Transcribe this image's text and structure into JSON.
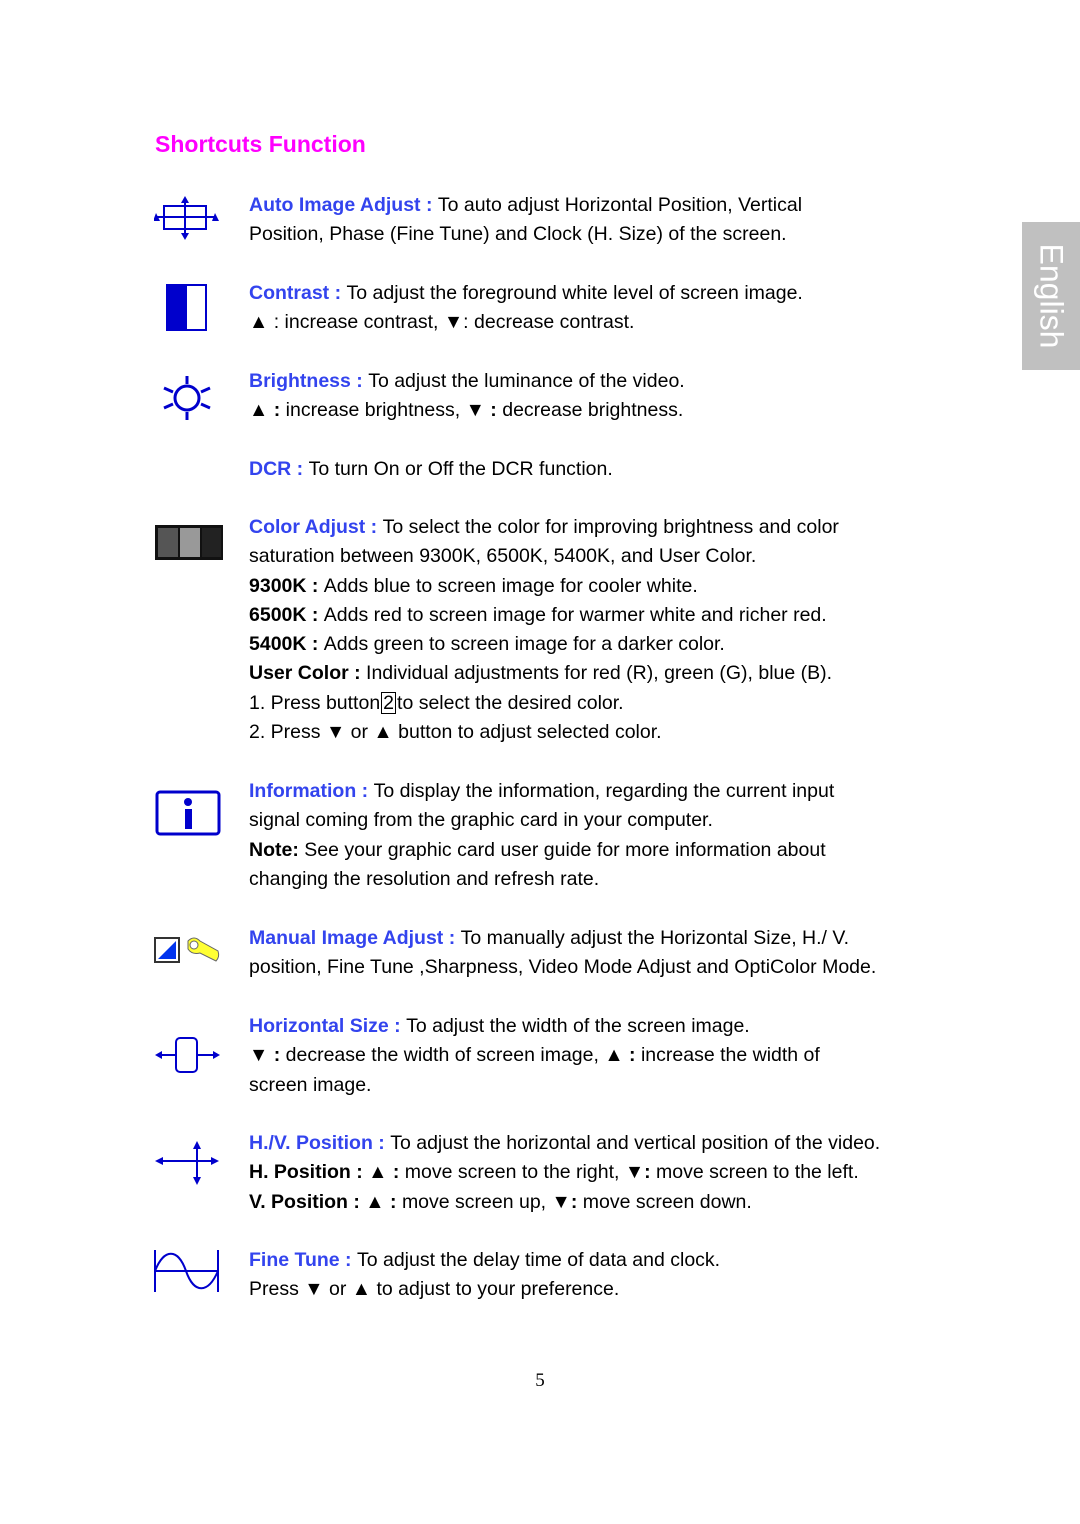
{
  "title": "Shortcuts Function",
  "side_tab": "English",
  "colors": {
    "title": "#ff00ff",
    "label": "#3344ee",
    "icon": "#0000cc",
    "tab_bg": "#c0c0c0"
  },
  "sections": {
    "auto": {
      "icon": "auto-image-adjust-icon",
      "label": "Auto Image Adjust : ",
      "line1": "To auto adjust Horizontal Position, Vertical",
      "line2": "Position, Phase (Fine Tune) and Clock (H. Size) of the screen."
    },
    "contrast": {
      "icon": "contrast-icon",
      "label": "Contrast : ",
      "line1": "To adjust the foreground white level of screen image.",
      "line2": "▲ : increase contrast, ▼: decrease contrast."
    },
    "brightness": {
      "icon": "brightness-icon",
      "label": "Brightness : ",
      "line1": "To adjust the luminance of the video.",
      "line2a": "▲ : ",
      "line2b": "increase brightness, ",
      "line2c": "▼ : ",
      "line2d": "decrease brightness."
    },
    "dcr": {
      "label": "DCR : ",
      "line1": "To turn On or Off the DCR function."
    },
    "color": {
      "icon": "color-adjust-icon",
      "label": "Color Adjust : ",
      "line1": "To select the color for improving brightness and color",
      "line2": "saturation between 9300K, 6500K, 5400K, and User Color.",
      "k9300_label": "9300K : ",
      "k9300": "Adds blue to screen image for cooler white.",
      "k6500_label": "6500K : ",
      "k6500": "Adds red to screen image for warmer white and richer red.",
      "k5400_label": "5400K : ",
      "k5400": "Adds green to screen image for a darker color.",
      "user_label": "User Color : ",
      "user": "Individual adjustments for red (R), green (G), blue (B).",
      "step1a": "1. Press button",
      "step1_btn": "2",
      "step1b": "to select the desired color.",
      "step2": "2. Press ▼ or ▲ button to adjust selected color."
    },
    "info": {
      "icon": "information-icon",
      "label": "Information : ",
      "line1": "To display the information, regarding the current input",
      "line2": "signal coming from the graphic card in your computer.",
      "note_label": "Note: ",
      "note": "See your graphic card user guide for more information about",
      "note2": "changing the resolution and refresh rate."
    },
    "manual": {
      "icon": "manual-image-adjust-icon",
      "label": "Manual Image Adjust : ",
      "line1": "To manually adjust the Horizontal Size, H./ V.",
      "line2": "position, Fine Tune ,Sharpness, Video Mode Adjust and OptiColor Mode."
    },
    "hsize": {
      "icon": "horizontal-size-icon",
      "label": "Horizontal Size : ",
      "line1": "To adjust the width of the screen image.",
      "line2a": "▼ : ",
      "line2b": "decrease the width of screen image, ",
      "line2c": "▲ : ",
      "line2d": "increase the width of",
      "line3": "screen image."
    },
    "hvpos": {
      "icon": "hv-position-icon",
      "label": "H./V. Position : ",
      "line1": "To adjust the horizontal and vertical position of the video.",
      "h_label": "H. Position : ▲ : ",
      "h_text1": "move screen to the right, ",
      "h_mid": "▼: ",
      "h_text2": "move screen to the left.",
      "v_label": "V. Position : ▲ : ",
      "v_text1": "move screen up, ",
      "v_mid": "▼: ",
      "v_text2": "move screen down."
    },
    "finetune": {
      "icon": "fine-tune-icon",
      "label": "Fine Tune : ",
      "line1": "To adjust the delay time of data and clock.",
      "line2": "Press ▼ or ▲ to adjust to your preference."
    }
  },
  "page_number": "5"
}
